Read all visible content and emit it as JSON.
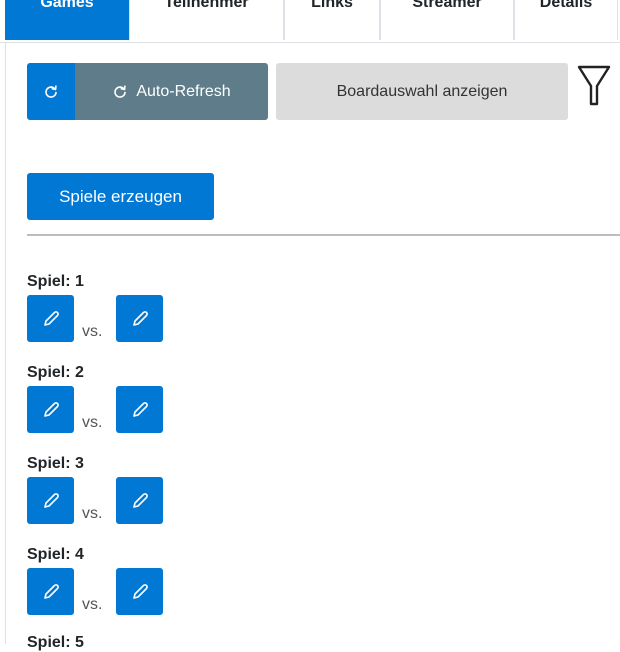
{
  "tabs": [
    {
      "label": "Games",
      "active": true
    },
    {
      "label": "Teilnehmer",
      "active": false
    },
    {
      "label": "Links",
      "active": false
    },
    {
      "label": "Streamer",
      "active": false
    },
    {
      "label": "Details",
      "active": false
    }
  ],
  "toolbar": {
    "auto_refresh_label": "Auto-Refresh",
    "board_label": "Boardauswahl anzeigen",
    "create_label": "Spiele erzeugen"
  },
  "games": [
    {
      "title": "Spiel: 1",
      "vs": "vs."
    },
    {
      "title": "Spiel: 2",
      "vs": "vs."
    },
    {
      "title": "Spiel: 3",
      "vs": "vs."
    },
    {
      "title": "Spiel: 4",
      "vs": "vs."
    },
    {
      "title": "Spiel: 5"
    }
  ],
  "icons": {
    "refresh": "refresh-icon",
    "filter": "filter-icon",
    "edit": "pencil-icon"
  },
  "colors": {
    "primary": "#0078d4",
    "secondary": "#5f7c8a",
    "light": "#dcdcdc"
  }
}
